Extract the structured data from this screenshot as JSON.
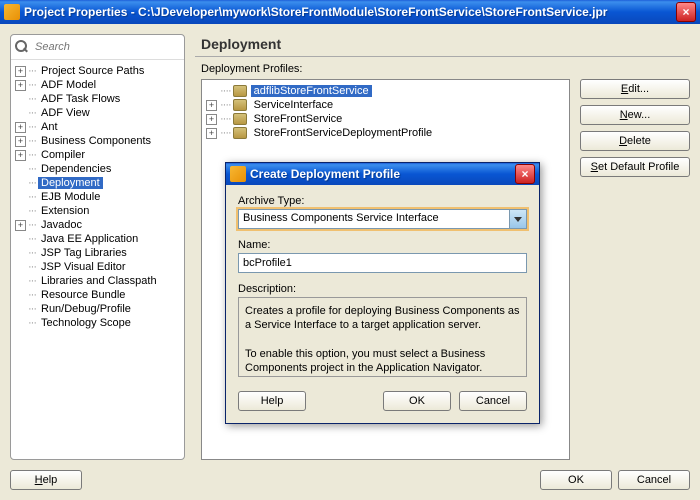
{
  "window": {
    "title": "Project Properties - C:\\JDeveloper\\mywork\\StoreFrontModule\\StoreFrontService\\StoreFrontService.jpr"
  },
  "search": {
    "placeholder": "Search"
  },
  "tree": {
    "items": [
      {
        "label": "Project Source Paths",
        "expandable": true
      },
      {
        "label": "ADF Model",
        "expandable": true
      },
      {
        "label": "ADF Task Flows",
        "expandable": false
      },
      {
        "label": "ADF View",
        "expandable": false
      },
      {
        "label": "Ant",
        "expandable": true
      },
      {
        "label": "Business Components",
        "expandable": true
      },
      {
        "label": "Compiler",
        "expandable": true
      },
      {
        "label": "Dependencies",
        "expandable": false
      },
      {
        "label": "Deployment",
        "expandable": false,
        "selected": true
      },
      {
        "label": "EJB Module",
        "expandable": false
      },
      {
        "label": "Extension",
        "expandable": false
      },
      {
        "label": "Javadoc",
        "expandable": true
      },
      {
        "label": "Java EE Application",
        "expandable": false
      },
      {
        "label": "JSP Tag Libraries",
        "expandable": false
      },
      {
        "label": "JSP Visual Editor",
        "expandable": false
      },
      {
        "label": "Libraries and Classpath",
        "expandable": false
      },
      {
        "label": "Resource Bundle",
        "expandable": false
      },
      {
        "label": "Run/Debug/Profile",
        "expandable": false
      },
      {
        "label": "Technology Scope",
        "expandable": false
      }
    ]
  },
  "main": {
    "title": "Deployment",
    "profiles_label": "Deployment Profiles:",
    "profiles": [
      {
        "label": "adflibStoreFrontService",
        "selected": true,
        "expandable": false
      },
      {
        "label": "ServiceInterface",
        "expandable": true
      },
      {
        "label": "StoreFrontService",
        "expandable": true
      },
      {
        "label": "StoreFrontServiceDeploymentProfile",
        "expandable": true
      }
    ],
    "buttons": {
      "edit": "Edit...",
      "new": "New...",
      "delete": "Delete",
      "set_default": "Set Default Profile"
    }
  },
  "footer": {
    "help": "Help",
    "ok": "OK",
    "cancel": "Cancel"
  },
  "modal": {
    "title": "Create Deployment Profile",
    "archive_label": "Archive Type:",
    "archive_value": "Business Components Service Interface",
    "name_label": "Name:",
    "name_value": "bcProfile1",
    "desc_label": "Description:",
    "desc_text": "Creates a profile for deploying Business Components as a Service Interface to a target application server.\n\nTo enable this option, you must select a Business Components project in the Application Navigator.",
    "help": "Help",
    "ok": "OK",
    "cancel": "Cancel"
  }
}
